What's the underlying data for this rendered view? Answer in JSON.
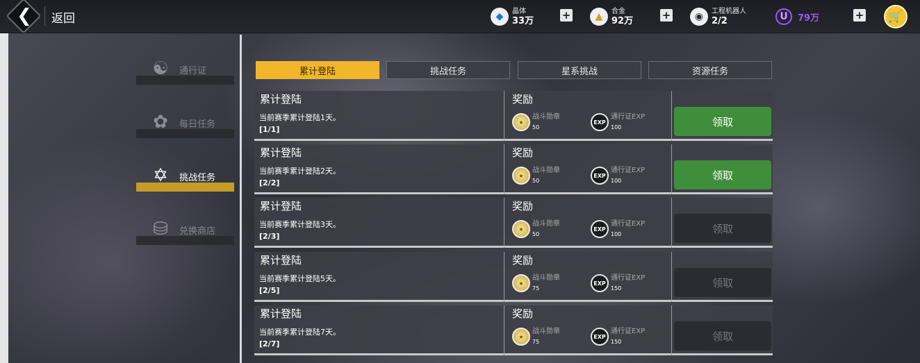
{
  "topbar": {
    "back_label": "返回",
    "resources": [
      {
        "label": "晶体",
        "value": "33万",
        "icon": "crystal-icon"
      },
      {
        "label": "合金",
        "value": "92万",
        "icon": "alloy-icon"
      },
      {
        "label": "工程机器人",
        "value": "2/2",
        "icon": "robot-icon"
      }
    ],
    "currency_value": "79万",
    "currency_letter": "U"
  },
  "nav": {
    "items": [
      {
        "label": "通行证",
        "icon": "pass-icon",
        "active": false
      },
      {
        "label": "每日任务",
        "icon": "daily-icon",
        "active": false
      },
      {
        "label": "挑战任务",
        "icon": "challenge-icon",
        "active": true
      },
      {
        "label": "兑换商店",
        "icon": "shop-icon",
        "active": false
      }
    ]
  },
  "tabs": [
    {
      "label": "累计登陆",
      "active": true
    },
    {
      "label": "挑战任务",
      "active": false
    },
    {
      "label": "星系挑战",
      "active": false
    },
    {
      "label": "资源任务",
      "active": false
    }
  ],
  "reward_header": "奖励",
  "reward_names": {
    "medal": "战斗勋章",
    "exp": "通行证EXP"
  },
  "tasks": [
    {
      "title": "累计登陆",
      "desc": "当前赛季累计登陆1天。",
      "progress": "[1/1]",
      "medal_qty": "50",
      "exp_qty": "100",
      "claim_label": "领取",
      "claimable": true
    },
    {
      "title": "累计登陆",
      "desc": "当前赛季累计登陆2天。",
      "progress": "[2/2]",
      "medal_qty": "50",
      "exp_qty": "100",
      "claim_label": "领取",
      "claimable": true
    },
    {
      "title": "累计登陆",
      "desc": "当前赛季累计登陆3天。",
      "progress": "[2/3]",
      "medal_qty": "50",
      "exp_qty": "100",
      "claim_label": "领取",
      "claimable": false
    },
    {
      "title": "累计登陆",
      "desc": "当前赛季累计登陆5天。",
      "progress": "[2/5]",
      "medal_qty": "75",
      "exp_qty": "150",
      "claim_label": "领取",
      "claimable": false
    },
    {
      "title": "累计登陆",
      "desc": "当前赛季累计登陆7天。",
      "progress": "[2/7]",
      "medal_qty": "75",
      "exp_qty": "150",
      "claim_label": "领取",
      "claimable": false
    }
  ],
  "colors": {
    "tab_active": "#f1b72b",
    "claim_enabled": "#3f8e3b",
    "claim_disabled": "#2b2c31",
    "nav_active": "#c79b28",
    "currency": "#9b5cf0"
  }
}
